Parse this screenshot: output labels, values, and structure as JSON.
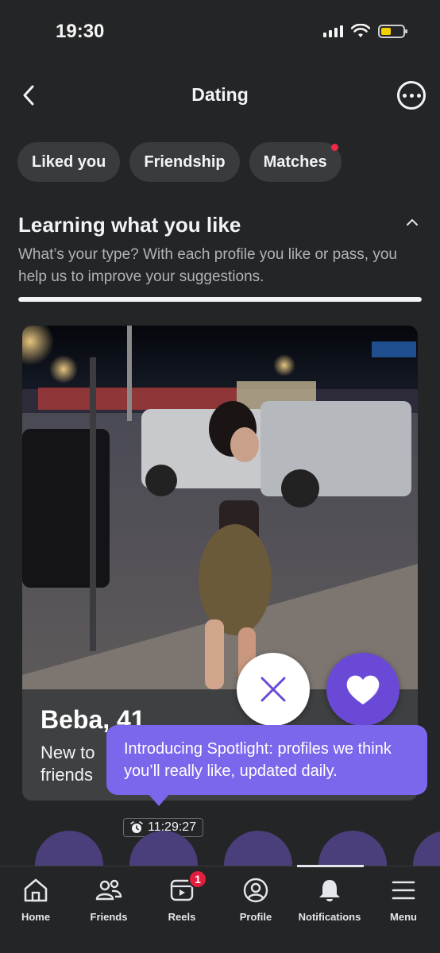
{
  "status_bar": {
    "time": "19:30"
  },
  "header": {
    "title": "Dating"
  },
  "chips": [
    {
      "label": "Liked you",
      "has_dot": false
    },
    {
      "label": "Friendship",
      "has_dot": false
    },
    {
      "label": "Matches",
      "has_dot": true
    }
  ],
  "learning": {
    "title": "Learning what you like",
    "description": "What’s your type? With each profile you like or pass, you help us to improve your suggestions.",
    "progress": 1.0
  },
  "profile_card": {
    "name_age": "Beba, 41",
    "subtitle": "New to friends"
  },
  "tooltip": {
    "text": "Introducing Spotlight: profiles we think you’ll really like, updated daily."
  },
  "timer": {
    "value": "11:29:27"
  },
  "tabbar": {
    "items": [
      {
        "label": "Home",
        "icon": "home-icon"
      },
      {
        "label": "Friends",
        "icon": "friends-icon"
      },
      {
        "label": "Reels",
        "icon": "reels-icon",
        "badge": "1"
      },
      {
        "label": "Profile",
        "icon": "profile-icon"
      },
      {
        "label": "Notifications",
        "icon": "bell-icon"
      },
      {
        "label": "Menu",
        "icon": "menu-icon"
      }
    ]
  },
  "colors": {
    "background": "#242526",
    "accent": "#6a49d6",
    "tooltip": "#7b67ec",
    "badge": "#e41e3f"
  }
}
